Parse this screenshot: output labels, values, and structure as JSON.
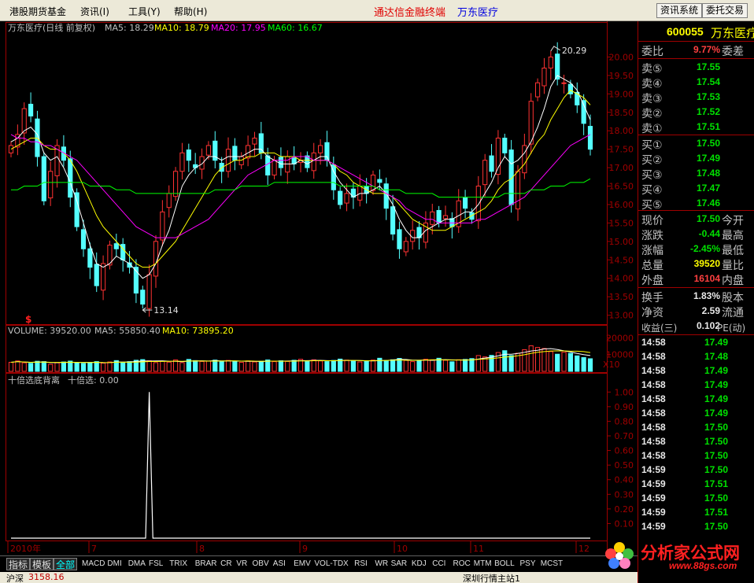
{
  "menu": {
    "items": [
      "港股期货基金",
      "资讯(I)",
      "工具(Y)",
      "帮助(H)"
    ],
    "center_title": "通达信金融终端",
    "center_stock": "万东医疗",
    "buttons": [
      "资讯系统",
      "委托交易"
    ]
  },
  "chart_data": [
    {
      "type": "candlestick",
      "title": "万东医疗(日线 前复权)",
      "indicators": [
        {
          "name": "MA5",
          "value": "18.29",
          "color": "#ffffff"
        },
        {
          "name": "MA10",
          "value": "18.79",
          "color": "#ffff00"
        },
        {
          "name": "MA20",
          "value": "17.95",
          "color": "#ff00ff"
        },
        {
          "name": "MA60",
          "value": "16.67",
          "color": "#00ff00"
        }
      ],
      "ylim": [
        12.8,
        20.5
      ],
      "y_ticks": [
        "20.00",
        "19.50",
        "19.00",
        "18.50",
        "18.00",
        "17.50",
        "17.00",
        "16.50",
        "16.00",
        "15.50",
        "15.00",
        "14.50",
        "14.00",
        "13.50",
        "13.00"
      ],
      "x_ticks": [
        "2010年",
        "7",
        "8",
        "9",
        "10",
        "11",
        "12"
      ],
      "annotations": {
        "high": "20.29",
        "low": "13.14",
        "marker": "$"
      },
      "closes": [
        17.6,
        17.9,
        18.6,
        18.4,
        17.3,
        16.1,
        16.9,
        17.6,
        17.2,
        16.2,
        15.4,
        14.8,
        14.3,
        13.8,
        14.4,
        14.9,
        14.8,
        14.5,
        14.3,
        13.6,
        13.3,
        14.1,
        15.0,
        15.8,
        16.3,
        16.9,
        17.4,
        17.2,
        17.0,
        17.3,
        17.6,
        17.2,
        16.9,
        17.5,
        17.2,
        17.3,
        17.6,
        17.8,
        17.4,
        16.8,
        17.2,
        17.0,
        17.3,
        17.1,
        17.2,
        17.0,
        17.4,
        17.6,
        17.2,
        16.4,
        16.0,
        16.3,
        16.2,
        16.5,
        16.3,
        16.8,
        16.6,
        15.9,
        15.2,
        14.8,
        15.0,
        15.3,
        15.1,
        15.5,
        15.8,
        15.5,
        15.7,
        15.4,
        16.1,
        15.9,
        15.6,
        16.5,
        17.2,
        16.9,
        17.8,
        17.4,
        16.0,
        16.9,
        17.6,
        18.8,
        19.3,
        19.7,
        20.0,
        19.4,
        19.3,
        19.0,
        18.7,
        18.2,
        17.5
      ],
      "ma_lines": {
        "ma5": [
          17.7,
          17.8,
          18.0,
          18.1,
          17.9,
          17.4,
          17.2,
          17.3,
          17.0,
          16.6,
          16.1,
          15.5,
          14.9,
          14.4,
          14.3,
          14.4,
          14.6,
          14.5,
          14.4,
          14.2,
          14.0,
          14.1,
          14.4,
          14.9,
          15.3,
          15.9,
          16.5,
          16.8,
          17.0,
          17.1,
          17.3,
          17.3,
          17.2,
          17.3,
          17.3,
          17.3,
          17.4,
          17.5,
          17.5,
          17.3,
          17.2,
          17.1,
          17.1,
          17.1,
          17.2,
          17.1,
          17.2,
          17.3,
          17.3,
          16.9,
          16.6,
          16.4,
          16.2,
          16.3,
          16.3,
          16.4,
          16.5,
          16.3,
          16.0,
          15.6,
          15.3,
          15.1,
          15.1,
          15.3,
          15.4,
          15.5,
          15.6,
          15.6,
          15.7,
          15.8,
          15.8,
          16.0,
          16.3,
          16.6,
          17.0,
          17.3,
          17.1,
          17.2,
          17.4,
          17.7,
          18.1,
          18.6,
          19.2,
          19.5,
          19.4,
          19.3,
          19.1,
          18.7,
          18.3
        ],
        "ma10": [
          17.5,
          17.6,
          17.7,
          17.8,
          17.8,
          17.6,
          17.5,
          17.5,
          17.4,
          17.2,
          16.9,
          16.5,
          16.1,
          15.7,
          15.4,
          15.2,
          15.0,
          14.8,
          14.6,
          14.4,
          14.3,
          14.3,
          14.4,
          14.6,
          14.8,
          15.0,
          15.3,
          15.6,
          15.9,
          16.2,
          16.5,
          16.8,
          17.0,
          17.1,
          17.2,
          17.2,
          17.3,
          17.3,
          17.4,
          17.4,
          17.4,
          17.3,
          17.3,
          17.3,
          17.2,
          17.2,
          17.2,
          17.2,
          17.2,
          17.1,
          16.9,
          16.8,
          16.6,
          16.5,
          16.4,
          16.3,
          16.3,
          16.3,
          16.2,
          16.0,
          15.8,
          15.6,
          15.5,
          15.4,
          15.3,
          15.3,
          15.3,
          15.4,
          15.5,
          15.6,
          15.7,
          15.8,
          15.9,
          16.1,
          16.4,
          16.6,
          16.7,
          16.9,
          17.1,
          17.4,
          17.7,
          17.9,
          18.3,
          18.6,
          18.9,
          19.1,
          19.0,
          18.9,
          18.7
        ],
        "ma20": [
          17.9,
          17.8,
          17.8,
          17.7,
          17.7,
          17.6,
          17.6,
          17.5,
          17.4,
          17.3,
          17.2,
          17.0,
          16.8,
          16.6,
          16.4,
          16.2,
          16.0,
          15.8,
          15.6,
          15.4,
          15.3,
          15.2,
          15.1,
          15.1,
          15.1,
          15.1,
          15.2,
          15.3,
          15.4,
          15.5,
          15.6,
          15.8,
          16.0,
          16.2,
          16.4,
          16.6,
          16.8,
          16.9,
          17.0,
          17.1,
          17.2,
          17.2,
          17.2,
          17.3,
          17.3,
          17.3,
          17.2,
          17.2,
          17.2,
          17.1,
          17.0,
          16.9,
          16.8,
          16.7,
          16.6,
          16.5,
          16.4,
          16.3,
          16.2,
          16.1,
          15.9,
          15.8,
          15.7,
          15.6,
          15.6,
          15.5,
          15.5,
          15.5,
          15.5,
          15.5,
          15.5,
          15.6,
          15.6,
          15.7,
          15.8,
          15.9,
          16.0,
          16.1,
          16.2,
          16.4,
          16.6,
          16.8,
          17.0,
          17.2,
          17.4,
          17.6,
          17.7,
          17.8,
          17.9
        ],
        "ma60": [
          16.4,
          16.4,
          16.5,
          16.5,
          16.5,
          16.6,
          16.6,
          16.6,
          16.6,
          16.6,
          16.6,
          16.6,
          16.5,
          16.5,
          16.5,
          16.5,
          16.4,
          16.4,
          16.4,
          16.3,
          16.3,
          16.3,
          16.3,
          16.3,
          16.3,
          16.3,
          16.3,
          16.3,
          16.3,
          16.3,
          16.3,
          16.4,
          16.4,
          16.4,
          16.4,
          16.5,
          16.5,
          16.5,
          16.5,
          16.5,
          16.6,
          16.6,
          16.6,
          16.6,
          16.6,
          16.6,
          16.6,
          16.6,
          16.6,
          16.6,
          16.5,
          16.5,
          16.5,
          16.5,
          16.5,
          16.5,
          16.4,
          16.4,
          16.4,
          16.4,
          16.3,
          16.3,
          16.3,
          16.3,
          16.3,
          16.2,
          16.2,
          16.2,
          16.2,
          16.2,
          16.2,
          16.2,
          16.2,
          16.2,
          16.2,
          16.3,
          16.3,
          16.3,
          16.3,
          16.4,
          16.4,
          16.4,
          16.5,
          16.5,
          16.5,
          16.6,
          16.6,
          16.6,
          16.7
        ]
      }
    },
    {
      "type": "bar",
      "title": "VOLUME",
      "indicators": [
        {
          "name": "VOLUME",
          "value": "39520.00",
          "color": "#c0c0c0"
        },
        {
          "name": "MA5",
          "value": "55850.40",
          "color": "#c0c0c0"
        },
        {
          "name": "MA10",
          "value": "73895.20",
          "color": "#ffff00"
        }
      ],
      "y_ticks": [
        "20000",
        "10000"
      ],
      "unit_label": "X10",
      "values": [
        5400,
        6200,
        5100,
        4800,
        6000,
        5800,
        4200,
        5100,
        5600,
        6100,
        5200,
        4700,
        5100,
        5800,
        4900,
        5600,
        6400,
        5100,
        5800,
        6600,
        7000,
        6300,
        5200,
        6100,
        5500,
        6800,
        5200,
        7100,
        6400,
        5900,
        6100,
        6700,
        5800,
        6500,
        6000,
        5400,
        6200,
        5600,
        6000,
        6800,
        5800,
        6300,
        5900,
        6600,
        7200,
        5800,
        6900,
        6200,
        5800,
        6500,
        7300,
        6700,
        6100,
        5600,
        5900,
        6700,
        7800,
        6500,
        6900,
        7700,
        6500,
        5800,
        6400,
        7200,
        6900,
        7800,
        6600,
        5700,
        6900,
        7100,
        7600,
        9400,
        8600,
        9500,
        11200,
        12300,
        9400,
        10800,
        12900,
        15200,
        14200,
        13600,
        11800,
        10200,
        11400,
        10700,
        9200,
        8200,
        7500
      ]
    },
    {
      "type": "line",
      "title": "十倍选底背离",
      "indicators": [
        {
          "name": "十倍选",
          "value": "0.00",
          "color": "#ffffff"
        }
      ],
      "ylim": [
        0,
        1.05
      ],
      "y_ticks": [
        "1.00",
        "0.90",
        "0.80",
        "0.70",
        "0.60",
        "0.50",
        "0.40",
        "0.30",
        "0.20",
        "0.10"
      ],
      "values": [
        0,
        0,
        0,
        0,
        0,
        0,
        0,
        0,
        0,
        0,
        0,
        0,
        0,
        0,
        0,
        0,
        0,
        0,
        0,
        0,
        0,
        1,
        0,
        0,
        0,
        0,
        0,
        0,
        0,
        0,
        0,
        0,
        0,
        0,
        0,
        0,
        0,
        0,
        0,
        0,
        0,
        0,
        0,
        0,
        0,
        0,
        0,
        0,
        0,
        0,
        0,
        0,
        0,
        0,
        0,
        0,
        0,
        0,
        0,
        0,
        0,
        0,
        0,
        0,
        0,
        0,
        0,
        0,
        0,
        0,
        0,
        0,
        0,
        0,
        0,
        0,
        0,
        0,
        0,
        0,
        0,
        0,
        0,
        0,
        0,
        0,
        0,
        0,
        0
      ]
    }
  ],
  "quote": {
    "code": "600055",
    "name": "万东医疗",
    "wei_bi_label": "委比",
    "wei_bi_value": "9.77%",
    "wei_cha_label": "委差",
    "sells": [
      {
        "label": "卖⑤",
        "price": "17.55"
      },
      {
        "label": "卖④",
        "price": "17.54"
      },
      {
        "label": "卖③",
        "price": "17.53"
      },
      {
        "label": "卖②",
        "price": "17.52"
      },
      {
        "label": "卖①",
        "price": "17.51"
      }
    ],
    "buys": [
      {
        "label": "买①",
        "price": "17.50"
      },
      {
        "label": "买②",
        "price": "17.49"
      },
      {
        "label": "买③",
        "price": "17.48"
      },
      {
        "label": "买④",
        "price": "17.47"
      },
      {
        "label": "买⑤",
        "price": "17.46"
      }
    ],
    "stats": [
      {
        "label": "现价",
        "value": "17.50",
        "color": "#00e000",
        "label2": "今开"
      },
      {
        "label": "涨跌",
        "value": "-0.44",
        "color": "#00e000",
        "label2": "最高"
      },
      {
        "label": "涨幅",
        "value": "-2.45%",
        "color": "#00e000",
        "label2": "最低"
      },
      {
        "label": "总量",
        "value": "39520",
        "color": "#ffff00",
        "label2": "量比"
      },
      {
        "label": "外盘",
        "value": "16104",
        "color": "#ff4040",
        "label2": "内盘"
      }
    ],
    "stats2": [
      {
        "label": "换手",
        "value": "1.83%",
        "label2": "股本"
      },
      {
        "label": "净资",
        "value": "2.59",
        "label2": "流通"
      },
      {
        "label": "收益(三)",
        "value": "0.102",
        "label2": "PE(动)"
      }
    ],
    "ticks": [
      {
        "time": "14:58",
        "price": "17.49"
      },
      {
        "time": "14:58",
        "price": "17.48"
      },
      {
        "time": "14:58",
        "price": "17.49"
      },
      {
        "time": "14:58",
        "price": "17.49"
      },
      {
        "time": "14:58",
        "price": "17.49"
      },
      {
        "time": "14:58",
        "price": "17.49"
      },
      {
        "time": "14:58",
        "price": "17.50"
      },
      {
        "time": "14:58",
        "price": "17.50"
      },
      {
        "time": "14:58",
        "price": "17.50"
      },
      {
        "time": "14:59",
        "price": "17.50"
      },
      {
        "time": "14:59",
        "price": "17.51"
      },
      {
        "time": "14:59",
        "price": "17.50"
      },
      {
        "time": "14:59",
        "price": "17.51"
      },
      {
        "time": "14:59",
        "price": "17.50"
      }
    ]
  },
  "tabs": {
    "boxed": [
      "指标",
      "模板",
      "全部"
    ],
    "indicators": [
      "MACD",
      "DMI",
      "DMA",
      "FSL",
      "TRIX",
      "BRAR",
      "CR",
      "VR",
      "OBV",
      "ASI",
      "EMV",
      "VOL-TDX",
      "RSI",
      "WR",
      "SAR",
      "KDJ",
      "CCI",
      "ROC",
      "MTM",
      "BOLL",
      "PSY",
      "MCST"
    ]
  },
  "status": {
    "left": "沪深",
    "value": "3158.16",
    "right": "深圳行情主站1"
  },
  "watermark": {
    "title": "分析家公式网",
    "url": "www.88gs.com"
  }
}
